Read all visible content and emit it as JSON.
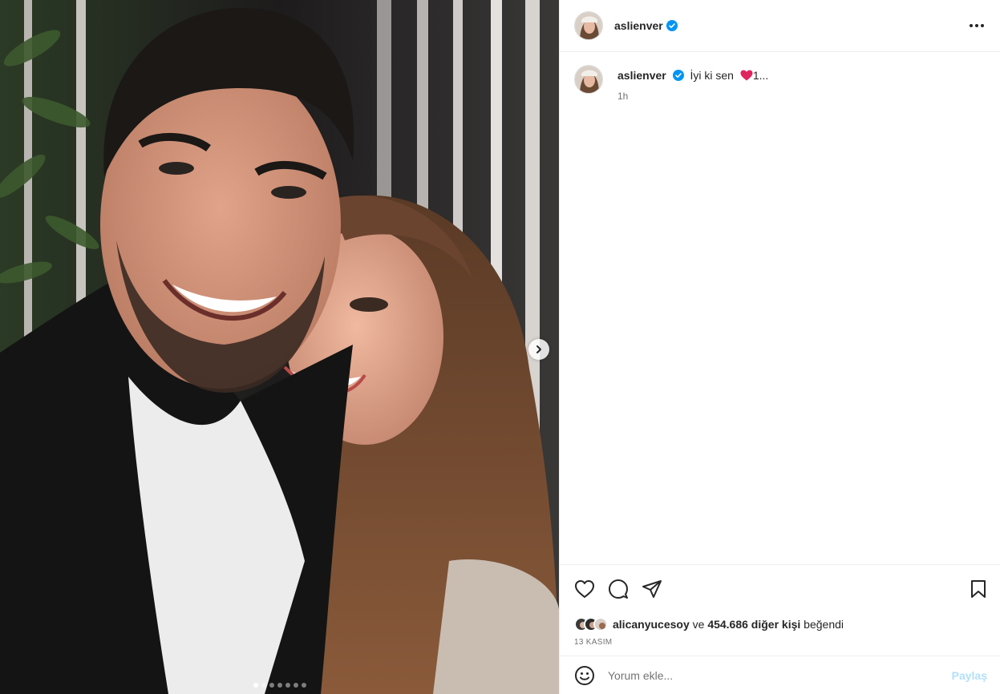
{
  "post": {
    "username": "aslienver",
    "caption_username": "aslienver",
    "caption_text": "İyi ki sen",
    "caption_suffix": "1...",
    "time_ago": "1h"
  },
  "carousel": {
    "slide_count": 7,
    "active_index": 0
  },
  "likes": {
    "liked_by": "alicanyucesoy",
    "connector": "ve",
    "others": "454.686 diğer kişi",
    "suffix": "beğendi"
  },
  "date": "13 KASIM",
  "comment_box": {
    "placeholder": "Yorum ekle...",
    "post_label": "Paylaş"
  },
  "colors": {
    "verified": "#0095f6",
    "heart": "#e0245e",
    "post_disabled": "#b2dffc"
  }
}
